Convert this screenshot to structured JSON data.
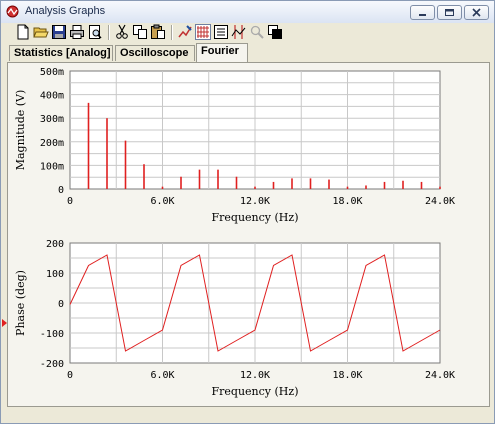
{
  "window": {
    "title": "Analysis Graphs",
    "icon": "analysis-graph-icon",
    "controls": [
      "minimize-icon",
      "maximize-icon",
      "close-icon"
    ]
  },
  "toolbar": {
    "buttons": [
      {
        "icon": "new-file-icon"
      },
      {
        "icon": "open-folder-icon"
      },
      {
        "icon": "save-icon"
      },
      {
        "icon": "print-icon"
      },
      {
        "icon": "print-preview-icon"
      },
      {
        "icon": "cut-icon"
      },
      {
        "icon": "copy-icon"
      },
      {
        "icon": "paste-icon"
      },
      {
        "icon": "graph-properties-icon"
      },
      {
        "icon": "toggle-grid-icon",
        "active": true
      },
      {
        "icon": "toggle-legend-icon"
      },
      {
        "icon": "cursors-icon"
      },
      {
        "icon": "zoom-icon",
        "disabled": true
      },
      {
        "icon": "reverse-colors-icon"
      }
    ]
  },
  "tabs": [
    {
      "label": "Statistics [Analog]",
      "active": false
    },
    {
      "label": "Oscilloscope",
      "active": false
    },
    {
      "label": "Fourier",
      "active": true
    }
  ],
  "colors": {
    "trace": "#e02020",
    "grid": "#c8c8c8",
    "plot_bg": "#ffffff"
  },
  "chart_data": [
    {
      "type": "bar",
      "xlabel": "Frequency (Hz)",
      "ylabel": "Magnitude (V)",
      "xlim": [
        0,
        24000
      ],
      "ylim": [
        0,
        0.5
      ],
      "x_ticks": [
        "0",
        "6.0K",
        "12.0K",
        "18.0K",
        "24.0K"
      ],
      "y_ticks": [
        "0",
        "100m",
        "200m",
        "300m",
        "400m",
        "500m"
      ],
      "grid": true,
      "x": [
        0,
        1200,
        2400,
        3600,
        4800,
        6000,
        7200,
        8400,
        9600,
        10800,
        12000,
        13200,
        14400,
        15600,
        16800,
        18000,
        19200,
        20400,
        21600,
        22800,
        24000
      ],
      "values": [
        0.0,
        0.365,
        0.3,
        0.205,
        0.105,
        0.01,
        0.052,
        0.082,
        0.082,
        0.052,
        0.01,
        0.03,
        0.045,
        0.045,
        0.04,
        0.01,
        0.015,
        0.03,
        0.035,
        0.03,
        0.01
      ]
    },
    {
      "type": "line",
      "xlabel": "Frequency (Hz)",
      "ylabel": "Phase (deg)",
      "xlim": [
        0,
        24000
      ],
      "ylim": [
        -200,
        200
      ],
      "x_ticks": [
        "0",
        "6.0K",
        "12.0K",
        "18.0K",
        "24.0K"
      ],
      "y_ticks": [
        "-200",
        "-100",
        "0",
        "100",
        "200"
      ],
      "grid": true,
      "x": [
        0,
        1200,
        2400,
        3600,
        4800,
        6000,
        7200,
        8400,
        9600,
        10800,
        12000,
        13200,
        14400,
        15600,
        16800,
        18000,
        19200,
        20400,
        21600,
        22800,
        24000
      ],
      "values": [
        -5,
        125,
        160,
        -160,
        -125,
        -90,
        125,
        160,
        -160,
        -125,
        -90,
        125,
        160,
        -160,
        -125,
        -90,
        125,
        160,
        -160,
        -125,
        -90
      ]
    }
  ]
}
